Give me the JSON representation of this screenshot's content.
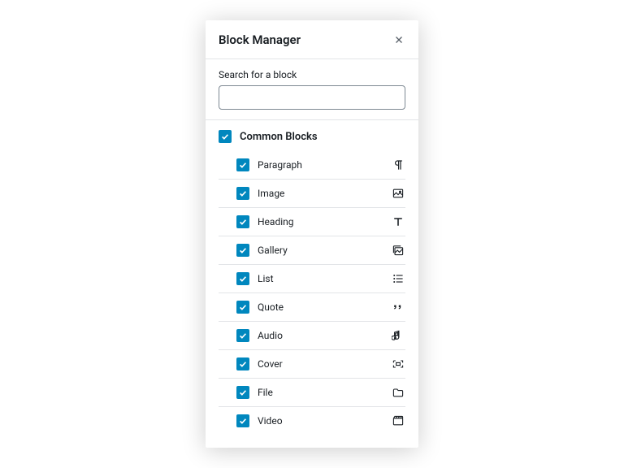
{
  "header": {
    "title": "Block Manager"
  },
  "search": {
    "label": "Search for a block",
    "value": ""
  },
  "category": {
    "label": "Common Blocks",
    "checked": true
  },
  "blocks": [
    {
      "label": "Paragraph",
      "icon": "paragraph",
      "checked": true
    },
    {
      "label": "Image",
      "icon": "image",
      "checked": true
    },
    {
      "label": "Heading",
      "icon": "heading",
      "checked": true
    },
    {
      "label": "Gallery",
      "icon": "gallery",
      "checked": true
    },
    {
      "label": "List",
      "icon": "list",
      "checked": true
    },
    {
      "label": "Quote",
      "icon": "quote",
      "checked": true
    },
    {
      "label": "Audio",
      "icon": "audio",
      "checked": true
    },
    {
      "label": "Cover",
      "icon": "cover",
      "checked": true
    },
    {
      "label": "File",
      "icon": "file",
      "checked": true
    },
    {
      "label": "Video",
      "icon": "video",
      "checked": true
    }
  ],
  "colors": {
    "accent": "#0087be"
  }
}
